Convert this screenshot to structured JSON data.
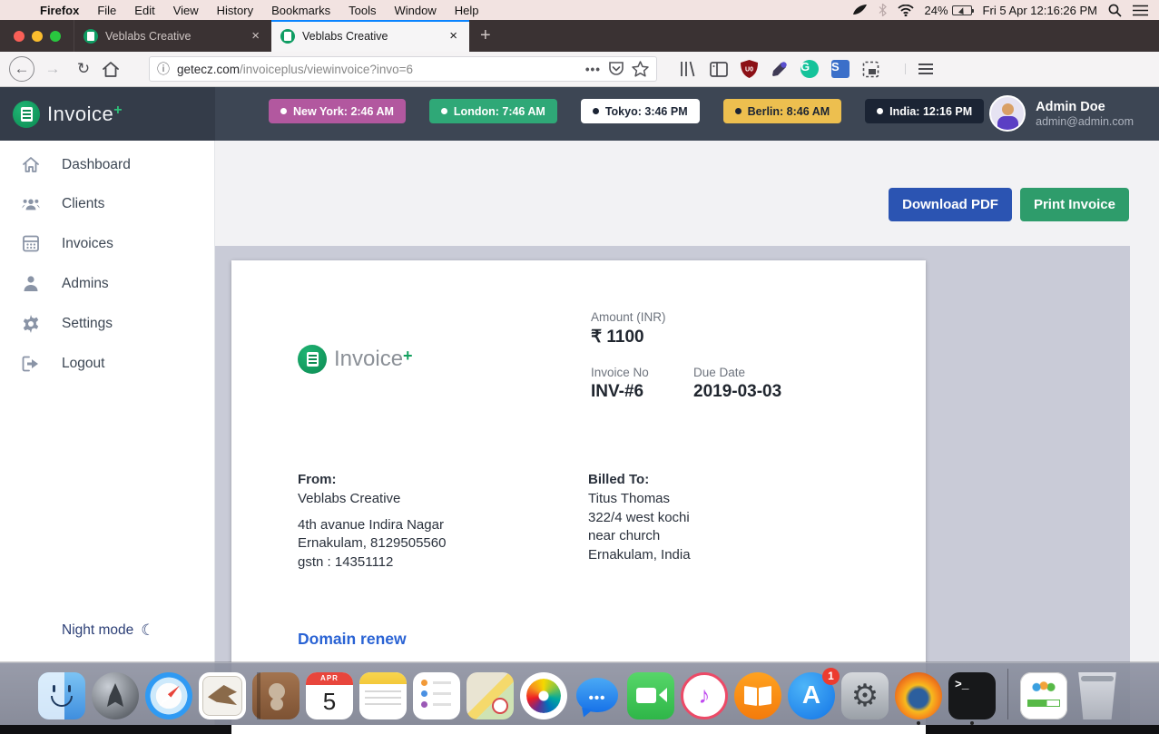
{
  "menubar": {
    "apple_menu": "",
    "items": [
      "Firefox",
      "File",
      "Edit",
      "View",
      "History",
      "Bookmarks",
      "Tools",
      "Window",
      "Help"
    ],
    "battery_percent": "24%",
    "clock": "Fri 5 Apr 12:16:26 PM"
  },
  "browser": {
    "tabs": [
      {
        "title": "Veblabs Creative",
        "active": false
      },
      {
        "title": "Veblabs Creative",
        "active": true
      }
    ],
    "new_tab_label": "+",
    "url_host": "getecz.com",
    "url_path": "/invoiceplus/viewinvoice?invo=6"
  },
  "header": {
    "brand": "Invoice",
    "brand_plus": "+",
    "timezones": [
      {
        "label": "New York: 2:46 AM",
        "color": "#b2589f"
      },
      {
        "label": "London: 7:46 AM",
        "color": "#2fa877"
      },
      {
        "label": "Tokyo: 3:46 PM",
        "color": "#ffffff"
      },
      {
        "label": "Berlin: 8:46 AM",
        "color": "#edbf4f"
      },
      {
        "label": "India: 12:16 PM",
        "color": "#1b2434"
      }
    ],
    "user": {
      "name": "Admin Doe",
      "email": "admin@admin.com"
    }
  },
  "sidebar": {
    "items": [
      {
        "label": "Dashboard"
      },
      {
        "label": "Clients"
      },
      {
        "label": "Invoices"
      },
      {
        "label": "Admins"
      },
      {
        "label": "Settings"
      },
      {
        "label": "Logout"
      }
    ],
    "night_mode_label": "Night mode"
  },
  "invoice": {
    "download_label": "Download PDF",
    "print_label": "Print Invoice",
    "brand": "Invoice",
    "brand_plus": "+",
    "amount_label": "Amount (INR)",
    "amount": "₹ 1100",
    "invoice_no_label": "Invoice No",
    "invoice_no": "INV-#6",
    "due_date_label": "Due Date",
    "due_date": "2019-03-03",
    "from_label": "From:",
    "from_name": "Veblabs Creative",
    "from_address": [
      "4th avanue Indira Nagar",
      "Ernakulam, 8129505560",
      "gstn : 14351112"
    ],
    "billed_label": "Billed To:",
    "billed_lines": [
      "Titus Thomas",
      "322/4 west kochi",
      "near church",
      "Ernakulam, India"
    ],
    "item_title": "Domain renew"
  },
  "dock": {
    "calendar": {
      "month": "APR",
      "day": "5"
    },
    "appstore_badge": "1",
    "items": [
      "Finder",
      "Launchpad",
      "Safari",
      "Mail",
      "Contacts",
      "Calendar",
      "Notes",
      "Reminders",
      "Maps",
      "Photos",
      "Messages",
      "FaceTime",
      "iTunes",
      "Books",
      "App Store",
      "System Preferences",
      "Firefox",
      "Terminal",
      "Shared Document",
      "Trash"
    ]
  },
  "colors": {
    "header_bg": "#3d4654",
    "download_btn": "#2b54b2",
    "print_btn": "#2e9c6b",
    "link_blue": "#2a63d4",
    "preview_bg": "#c9cbd7",
    "brand_green": "#0f9d63"
  }
}
